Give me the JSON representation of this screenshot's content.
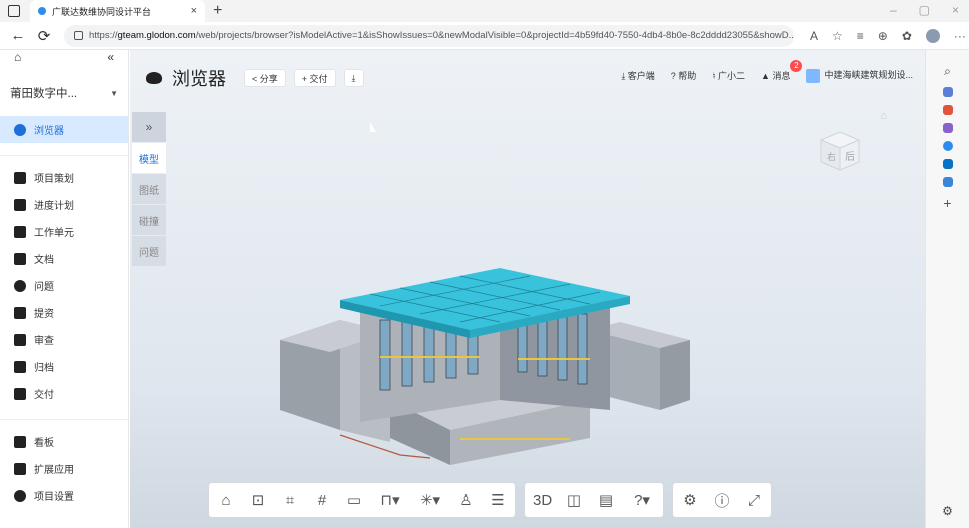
{
  "browser": {
    "tab_title": "广联达数维协同设计平台",
    "tab_close": "×",
    "new_tab": "+",
    "url_prefix": "https://",
    "url_host": "gteam.glodon.com",
    "url_path": "/web/projects/browser?isModelActive=1&isShowIssues=0&newModalVisible=0&projectId=4b59fd40-7550-4db4-8b0e-8c2dddd23055&showD...",
    "win_min": "–",
    "win_max": "▢",
    "win_close": "×",
    "more": "···"
  },
  "sidebar": {
    "project": "莆田数字中...",
    "items": [
      {
        "label": "浏览器"
      },
      {
        "label": "项目策划"
      },
      {
        "label": "进度计划"
      },
      {
        "label": "工作单元"
      },
      {
        "label": "文档"
      },
      {
        "label": "问题"
      },
      {
        "label": "提资"
      },
      {
        "label": "审查"
      },
      {
        "label": "归档"
      },
      {
        "label": "交付"
      },
      {
        "label": "看板"
      },
      {
        "label": "扩展应用"
      },
      {
        "label": "项目设置"
      }
    ]
  },
  "viewer": {
    "title": "浏览器",
    "share": "< 分享",
    "deliver": "+ 交付",
    "download": "⤓",
    "client": "⤓ 客户端",
    "help": "? 帮助",
    "assistant": "广小二",
    "messages": "消息",
    "message_count": "2",
    "user": "中建海峡建筑规划设...",
    "tabs": {
      "expand": "»",
      "model": "模型",
      "drawing": "图纸",
      "clash": "碰撞",
      "issue": "问题"
    },
    "cube_label_right": "右",
    "cube_label_back": "后"
  },
  "colors": {
    "accent": "#1e6fd9",
    "roof": "#39c2dc",
    "badge": "#ff4d4f"
  }
}
